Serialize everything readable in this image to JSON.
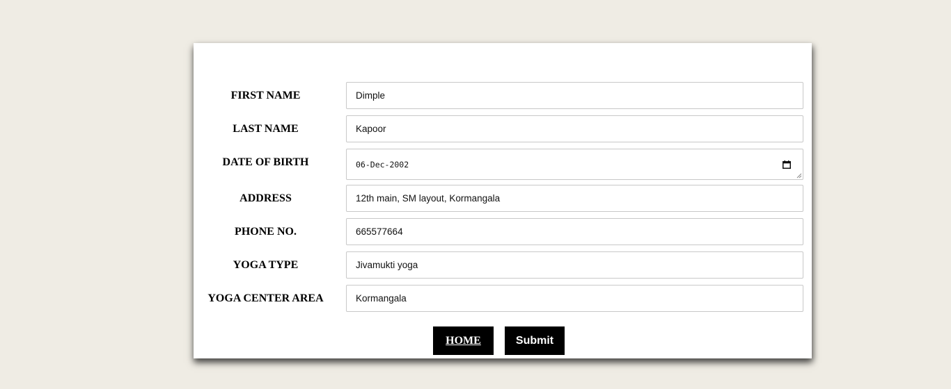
{
  "form": {
    "fields": [
      {
        "label": "FIRST NAME",
        "value": "Dimple"
      },
      {
        "label": "LAST NAME",
        "value": "Kapoor"
      },
      {
        "label": "DATE OF BIRTH",
        "value": "06-Dec-2002"
      },
      {
        "label": "ADDRESS",
        "value": "12th main, SM layout, Kormangala"
      },
      {
        "label": "PHONE NO.",
        "value": "665577664"
      },
      {
        "label": "YOGA TYPE",
        "value": "Jivamukti yoga"
      },
      {
        "label": "YOGA CENTER AREA",
        "value": "Kormangala"
      }
    ],
    "buttons": {
      "home_label": "HOME ",
      "submit_label": "Submit"
    }
  },
  "icons": {
    "date_picker": "calendar-icon"
  },
  "colors": {
    "page_background": "#efece4",
    "card_background": "#ffffff",
    "button_background": "#000000",
    "button_text": "#ffffff"
  }
}
